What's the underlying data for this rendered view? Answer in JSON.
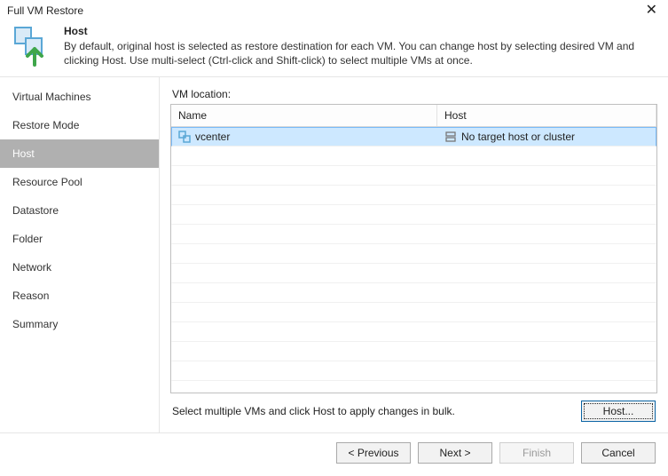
{
  "window": {
    "title": "Full VM Restore"
  },
  "header": {
    "heading": "Host",
    "description": "By default, original host is selected as restore destination for each VM. You can change host by selecting desired VM and clicking Host. Use multi-select (Ctrl-click and Shift-click) to select multiple VMs at once."
  },
  "sidebar": {
    "items": [
      {
        "label": "Virtual Machines"
      },
      {
        "label": "Restore Mode"
      },
      {
        "label": "Host"
      },
      {
        "label": "Resource Pool"
      },
      {
        "label": "Datastore"
      },
      {
        "label": "Folder"
      },
      {
        "label": "Network"
      },
      {
        "label": "Reason"
      },
      {
        "label": "Summary"
      }
    ],
    "selected_index": 2
  },
  "main": {
    "section_label": "VM location:",
    "columns": {
      "name": "Name",
      "host": "Host"
    },
    "rows": [
      {
        "name": "vcenter",
        "host": "No target host or cluster",
        "selected": true
      }
    ],
    "bulk_hint": "Select multiple VMs and click Host to apply changes in bulk.",
    "host_button": "Host..."
  },
  "footer": {
    "previous": "< Previous",
    "next": "Next >",
    "finish": "Finish",
    "cancel": "Cancel",
    "finish_enabled": false
  }
}
